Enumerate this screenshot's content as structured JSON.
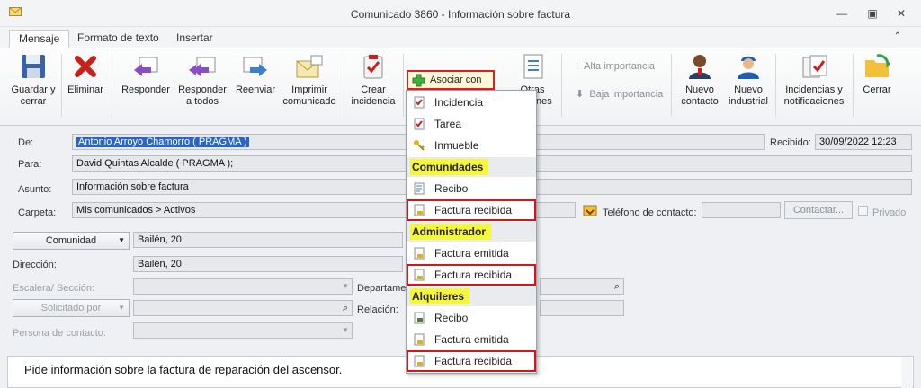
{
  "window": {
    "title": "Comunicado 3860 - Información sobre factura"
  },
  "tabs": [
    {
      "label": "Mensaje",
      "active": true
    },
    {
      "label": "Formato de texto",
      "active": false
    },
    {
      "label": "Insertar",
      "active": false
    }
  ],
  "ribbon": {
    "guardar": "Guardar y cerrar",
    "eliminar": "Eliminar",
    "responder": "Responder",
    "responder_todos": "Responder a todos",
    "reenviar": "Reenviar",
    "imprimir": "Imprimir comunicado",
    "crear_incidencia": "Crear incidencia",
    "asociar": "Asociar con",
    "otras": "Otras acciones",
    "alta": "Alta importancia",
    "baja": "Baja importancia",
    "nuevo_contacto": "Nuevo contacto",
    "nuevo_industrial": "Nuevo industrial",
    "incidencias_notif": "Incidencias y notificaciones",
    "cerrar": "Cerrar"
  },
  "dropdown": {
    "incidencia": "Incidencia",
    "tarea": "Tarea",
    "inmueble": "Inmueble",
    "h_comunidades": "Comunidades",
    "recibo1": "Recibo",
    "factura_recibida1": "Factura recibida",
    "h_administrador": "Administrador",
    "factura_emitida1": "Factura emitida",
    "factura_recibida2": "Factura recibida",
    "h_alquileres": "Alquileres",
    "recibo2": "Recibo",
    "factura_emitida2": "Factura emitida",
    "factura_recibida3": "Factura recibida"
  },
  "form": {
    "de_label": "De:",
    "de_value": "Antonio Arroyo Chamorro ( PRAGMA )",
    "recibido_label": "Recibido:",
    "recibido_value": "30/09/2022 12:23",
    "para_label": "Para:",
    "para_value": "David Quintas Alcalde ( PRAGMA );",
    "asunto_label": "Asunto:",
    "asunto_value": "Información sobre factura",
    "carpeta_label": "Carpeta:",
    "carpeta_value": "Mis comunicados > Activos",
    "telefono_label": "Teléfono de contacto:",
    "contactar": "Contactar...",
    "privado": "Privado"
  },
  "panel": {
    "comunidad_btn": "Comunidad",
    "comunidad_value": "Bailén, 20",
    "direccion_label": "Dirección:",
    "direccion_value": "Bailén, 20",
    "escalera_label": "Escalera/ Sección:",
    "departamento_label": "Departamento:",
    "solicitado_btn": "Solicitado por",
    "relacion_label": "Relación:",
    "persona_label": "Persona de contacto:"
  },
  "body": {
    "text": "Pide información sobre la factura de reparación del ascensor."
  },
  "colors": {
    "highlight_border": "#e0201c",
    "section_highlight": "#f7f73a",
    "selection": "#2a65c2"
  }
}
